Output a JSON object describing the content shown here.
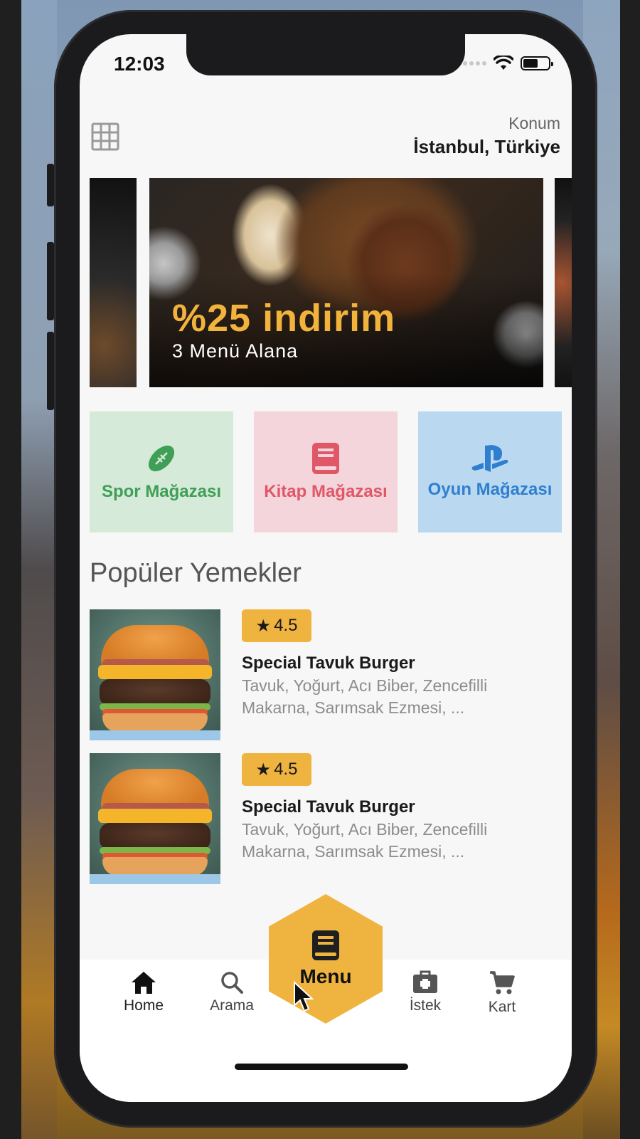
{
  "status": {
    "time": "12:03"
  },
  "header": {
    "location_label": "Konum",
    "location_value": "İstanbul, Türkiye"
  },
  "banner": {
    "title": "%25 indirim",
    "subtitle": "3 Menü Alana"
  },
  "categories": [
    {
      "label": "Spor Mağazası",
      "icon": "football-icon",
      "color": "#3f9f56",
      "bg": "#d5ead9"
    },
    {
      "label": "Kitap Mağazası",
      "icon": "book-icon",
      "color": "#e05767",
      "bg": "#f3d5db"
    },
    {
      "label": "Oyun Mağazası",
      "icon": "playstation-icon",
      "color": "#2f7fd0",
      "bg": "#bad8ef"
    }
  ],
  "popular": {
    "title": "Popüler Yemekler",
    "items": [
      {
        "rating": "4.5",
        "name": "Special Tavuk Burger",
        "desc": "Tavuk, Yoğurt, Acı Biber, Zencefilli Makarna, Sarımsak Ezmesi, ..."
      },
      {
        "rating": "4.5",
        "name": "Special Tavuk Burger",
        "desc": "Tavuk, Yoğurt, Acı Biber, Zencefilli Makarna, Sarımsak Ezmesi, ..."
      }
    ]
  },
  "tabbar": {
    "home": "Home",
    "search": "Arama",
    "menu": "Menu",
    "wish": "İstek",
    "cart": "Kart"
  },
  "colors": {
    "accent": "#efb43f"
  }
}
